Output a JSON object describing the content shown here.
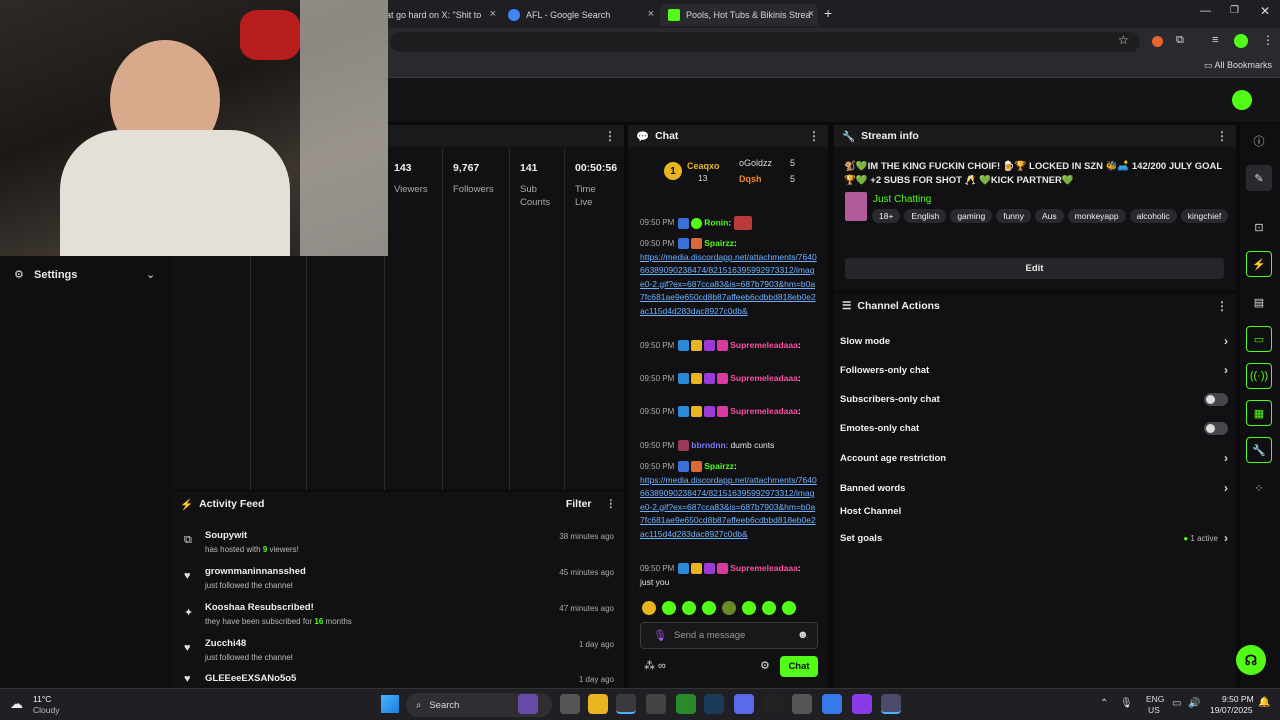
{
  "browser": {
    "tabs": [
      {
        "label": "at go hard on X: \"Shit to",
        "color": "#1d1d1d"
      },
      {
        "label": "AFL - Google Search",
        "color": "#4285f4"
      },
      {
        "label": "Pools, Hot Tubs & Bikinis Strea",
        "color": "#53fc18"
      }
    ],
    "new_tab": "+",
    "bookmarks_label": "All Bookmarks"
  },
  "stats": [
    {
      "value": "143",
      "label": "Viewers"
    },
    {
      "value": "9,767",
      "label": "Followers"
    },
    {
      "value": "141",
      "label": "Sub Counts"
    },
    {
      "value": "00:50:56",
      "label": "Time Live"
    }
  ],
  "settings": {
    "label": "Settings"
  },
  "chat": {
    "title": "Chat",
    "leaders": {
      "rank": "1",
      "first_name": "Ceaqxo",
      "first_count": "13",
      "second_name": "oGoldzz",
      "second_count": "5",
      "third_name": "Dqsh",
      "third_count": "5"
    },
    "messages": [
      {
        "time": "09:50 PM",
        "user": "Ronin",
        "user_color": "#53fc18",
        "text": ""
      },
      {
        "time": "09:50 PM",
        "user": "Spairzz",
        "user_color": "#53fc18",
        "link": "https://media.discordapp.net/attachments/764066389090238474/821516395992973312/image0-2.gif?ex=687cca83&is=687b7903&hm=b0a7fc681ae9e650cd8b87affeeb6cdbbd818eb0e2ac115d4d283dac8927c0db&"
      },
      {
        "time": "09:50 PM",
        "user": "Supremeleadaaa",
        "user_color": "#ff4fa3",
        "text": ""
      },
      {
        "time": "09:50 PM",
        "user": "Supremeleadaaa",
        "user_color": "#ff4fa3",
        "text": ""
      },
      {
        "time": "09:50 PM",
        "user": "Supremeleadaaa",
        "user_color": "#ff4fa3",
        "text": ""
      },
      {
        "time": "09:50 PM",
        "user": "bbrndnn",
        "user_color": "#7a7aff",
        "text": "dumb cunts"
      },
      {
        "time": "09:50 PM",
        "user": "Spairzz",
        "user_color": "#53fc18",
        "link": "https://media.discordapp.net/attachments/764066389090238474/821516395992973312/image0-2.gif?ex=687cca83&is=687b7903&hm=b0a7fc681ae9e650cd8b87affeeb6cdbbd818eb0e2ac115d4d283dac8927c0db&"
      },
      {
        "time": "09:50 PM",
        "user": "Supremeleadaaa",
        "user_color": "#ff4fa3",
        "text": "just you"
      }
    ],
    "input_placeholder": "Send a message",
    "send_label": "Chat"
  },
  "stream_info": {
    "title": "Stream info",
    "stream_title": "🐒💚IM THE KING FUCKIN CHOIF! 🍺🏆 LOCKED IN SZN 🐝🛋️ 142/200 JULY GOAL 🏆💚 +2 SUBS FOR SHOT 🥂 💚KICK PARTNER💚",
    "category": "Just Chatting",
    "tags": [
      "18+",
      "English",
      "gaming",
      "funny",
      "Aus",
      "monkeyapp",
      "alcoholic",
      "kingchief"
    ],
    "edit_label": "Edit"
  },
  "channel_actions": {
    "title": "Channel Actions",
    "items": [
      {
        "label": "Slow mode",
        "control": "chevron"
      },
      {
        "label": "Followers-only chat",
        "control": "chevron"
      },
      {
        "label": "Subscribers-only chat",
        "control": "toggle"
      },
      {
        "label": "Emotes-only chat",
        "control": "toggle"
      },
      {
        "label": "Account age restriction",
        "control": "chevron"
      },
      {
        "label": "Banned words",
        "control": "chevron"
      },
      {
        "label": "Host Channel",
        "control": "none"
      },
      {
        "label": "Set goals",
        "control": "chevron",
        "extra": "1 active"
      }
    ]
  },
  "activity": {
    "title": "Activity Feed",
    "filter_label": "Filter",
    "items": [
      {
        "name": "Soupywit",
        "pre": "has hosted with ",
        "count": "9",
        "post": " viewers!",
        "time": "38 minutes ago",
        "icon": "host-icon"
      },
      {
        "name": "grownmaninnansshed",
        "pre": "just followed the channel",
        "count": "",
        "post": "",
        "time": "45 minutes ago",
        "icon": "heart-icon"
      },
      {
        "name": "Kooshaa Resubscribed!",
        "pre": "they have been subscribed for ",
        "count": "16",
        "post": " months",
        "time": "47 minutes ago",
        "icon": "star-icon"
      },
      {
        "name": "Zucchi48",
        "pre": "just followed the channel",
        "count": "",
        "post": "",
        "time": "1 day ago",
        "icon": "heart-icon"
      },
      {
        "name": "GLEEeeEXSANo5o5",
        "pre": "",
        "count": "",
        "post": "",
        "time": "1 day ago",
        "icon": "heart-icon"
      }
    ]
  },
  "taskbar": {
    "weather_temp": "11°C",
    "weather_desc": "Cloudy",
    "search_label": "Search",
    "lang": "ENG",
    "region": "US",
    "time": "9:50 PM",
    "date": "19/07/2025"
  },
  "colors": {
    "accent": "#53fc18",
    "link": "#6fb1ff"
  }
}
